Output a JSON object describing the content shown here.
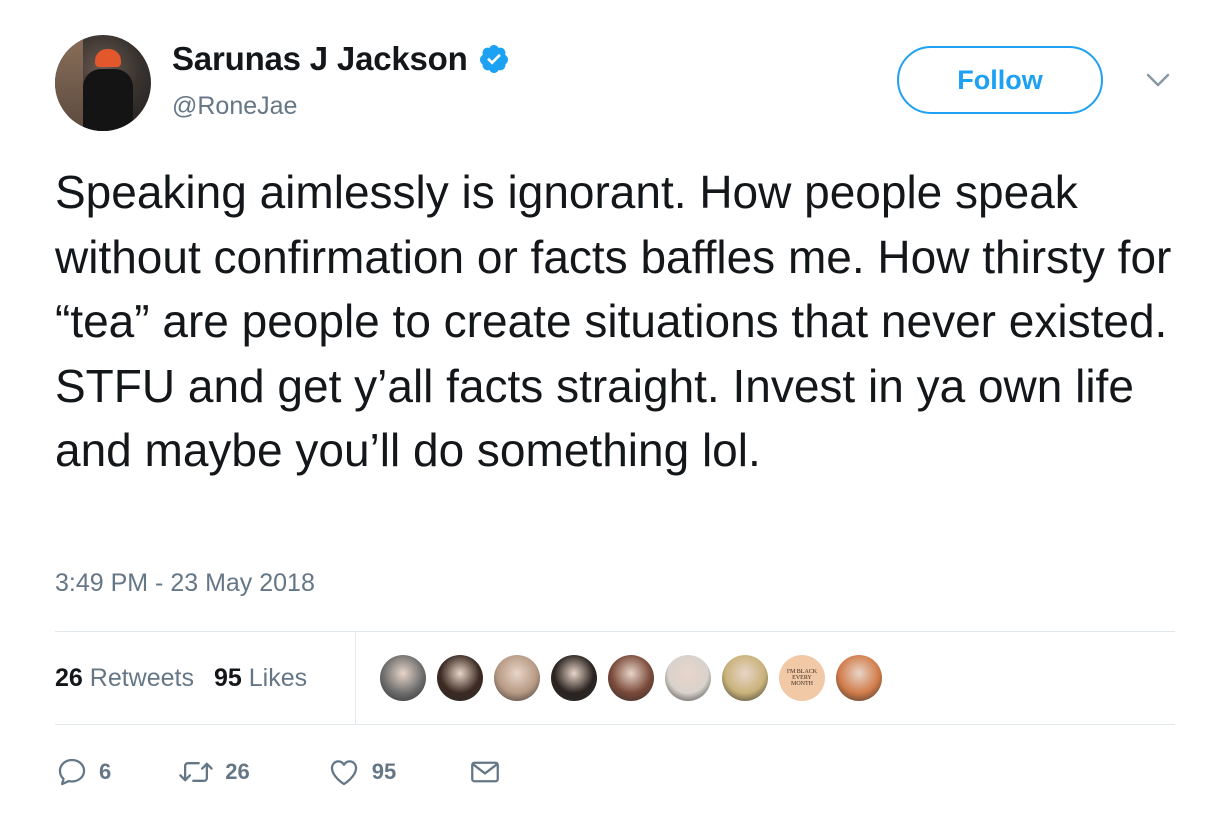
{
  "author": {
    "name": "Sarunas J Jackson",
    "handle": "@RoneJae",
    "verified": true
  },
  "follow_button": {
    "label": "Follow"
  },
  "tweet": {
    "text": "Speaking aimlessly is ignorant. How people speak without confirmation or facts baffles me. How thirsty for “tea” are people to create situations that never existed. STFU and get y’all facts straight. Invest in ya own life and maybe you’ll do something lol.",
    "timestamp": "3:49 PM - 23 May 2018"
  },
  "stats": {
    "retweets_count": "26",
    "retweets_label": "Retweets",
    "likes_count": "95",
    "likes_label": "Likes"
  },
  "likers": [
    {
      "name": "liker-1",
      "color": "#6e6e6e"
    },
    {
      "name": "liker-2",
      "color": "#3b2a22"
    },
    {
      "name": "liker-3",
      "color": "#b79a84"
    },
    {
      "name": "liker-4",
      "color": "#2a2320"
    },
    {
      "name": "liker-5",
      "color": "#7a4a3a"
    },
    {
      "name": "liker-6",
      "color": "#d9d2cc"
    },
    {
      "name": "liker-7",
      "color": "#c9b27a"
    },
    {
      "name": "liker-8",
      "text": "I'M BLACK EVERY MONTH",
      "color": "#f1c9a6"
    },
    {
      "name": "liker-9",
      "color": "#d27c4a"
    }
  ],
  "actions": {
    "reply_count": "6",
    "retweet_count": "26",
    "like_count": "95"
  },
  "colors": {
    "accent": "#1da1f2",
    "secondary_text": "#657786",
    "divider": "#e1e8ed"
  },
  "icons": {
    "verified": "verified-badge-icon",
    "chevron": "chevron-down-icon",
    "reply": "reply-icon",
    "retweet": "retweet-icon",
    "like": "heart-icon",
    "message": "envelope-icon"
  }
}
